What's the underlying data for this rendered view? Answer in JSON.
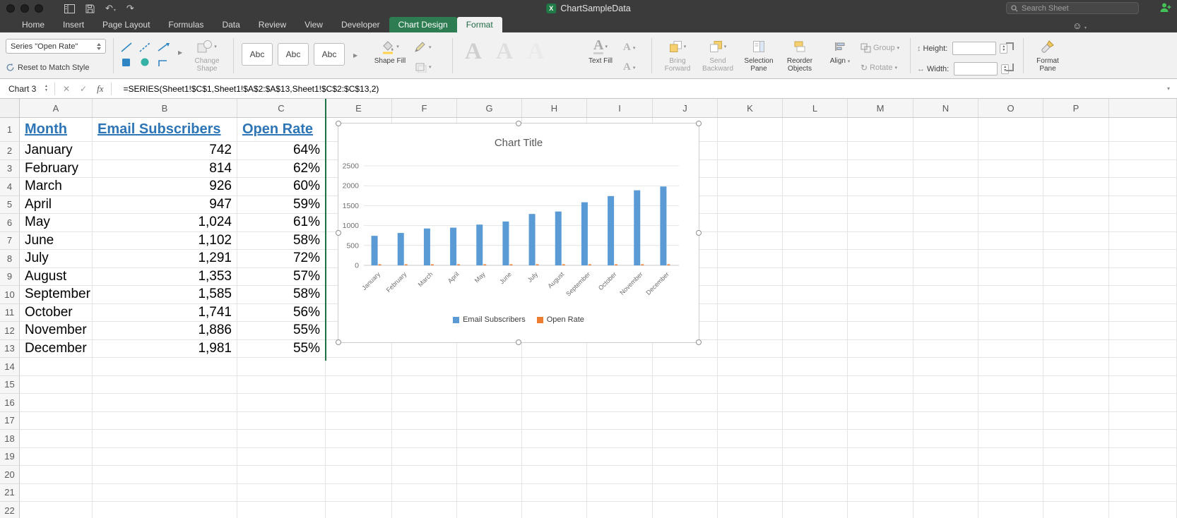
{
  "colors": {
    "accent_green": "#217346",
    "bar_blue": "#5b9bd5",
    "bar_orange": "#ed7d31",
    "link_blue": "#2e75b6"
  },
  "titlebar": {
    "title": "ChartSampleData",
    "search_placeholder": "Search Sheet"
  },
  "tabs": [
    {
      "label": "Home",
      "state": "normal"
    },
    {
      "label": "Insert",
      "state": "normal"
    },
    {
      "label": "Page Layout",
      "state": "normal"
    },
    {
      "label": "Formulas",
      "state": "normal"
    },
    {
      "label": "Data",
      "state": "normal"
    },
    {
      "label": "Review",
      "state": "normal"
    },
    {
      "label": "View",
      "state": "normal"
    },
    {
      "label": "Developer",
      "state": "normal"
    },
    {
      "label": "Chart Design",
      "state": "contextual"
    },
    {
      "label": "Format",
      "state": "active"
    }
  ],
  "ribbon": {
    "series_selector": "Series \"Open Rate\"",
    "reset_button": "Reset to Match Style",
    "change_shape": "Change Shape",
    "style_presets": [
      "Abc",
      "Abc",
      "Abc"
    ],
    "wordart_presets": [
      "A",
      "A",
      "A"
    ],
    "shape_fill": "Shape Fill",
    "text_fill": "Text Fill",
    "bring_forward": "Bring Forward",
    "send_backward": "Send Backward",
    "selection_pane": "Selection Pane",
    "reorder_objects": "Reorder Objects",
    "align": "Align",
    "group": "Group",
    "rotate": "Rotate",
    "height_label": "Height:",
    "width_label": "Width:",
    "height_value": "",
    "width_value": "",
    "format_pane": "Format Pane"
  },
  "formula_bar": {
    "name_box": "Chart 3",
    "fx_label": "fx",
    "formula": "=SERIES(Sheet1!$C$1,Sheet1!$A$2:$A$13,Sheet1!$C$2:$C$13,2)"
  },
  "grid": {
    "columns": [
      "A",
      "B",
      "C",
      "E",
      "F",
      "G",
      "H",
      "I",
      "J",
      "K",
      "L",
      "M",
      "N",
      "O",
      "P",
      ""
    ],
    "row_count": 22,
    "headers": [
      "Month",
      "Email Subscribers",
      "Open Rate"
    ],
    "rows": [
      [
        "January",
        "742",
        "64%"
      ],
      [
        "February",
        "814",
        "62%"
      ],
      [
        "March",
        "926",
        "60%"
      ],
      [
        "April",
        "947",
        "59%"
      ],
      [
        "May",
        "1,024",
        "61%"
      ],
      [
        "June",
        "1,102",
        "58%"
      ],
      [
        "July",
        "1,291",
        "72%"
      ],
      [
        "August",
        "1,353",
        "57%"
      ],
      [
        "September",
        "1,585",
        "58%"
      ],
      [
        "October",
        "1,741",
        "56%"
      ],
      [
        "November",
        "1,886",
        "55%"
      ],
      [
        "December",
        "1,981",
        "55%"
      ]
    ]
  },
  "chart_data": {
    "type": "bar",
    "title": "Chart Title",
    "categories": [
      "January",
      "February",
      "March",
      "April",
      "May",
      "June",
      "July",
      "August",
      "September",
      "October",
      "November",
      "December"
    ],
    "series": [
      {
        "name": "Email Subscribers",
        "color": "#5b9bd5",
        "values": [
          742,
          814,
          926,
          947,
          1024,
          1102,
          1291,
          1353,
          1585,
          1741,
          1886,
          1981
        ]
      },
      {
        "name": "Open Rate",
        "color": "#ed7d31",
        "values": [
          0.64,
          0.62,
          0.6,
          0.59,
          0.61,
          0.58,
          0.72,
          0.57,
          0.58,
          0.56,
          0.55,
          0.55
        ]
      }
    ],
    "y_ticks": [
      0,
      500,
      1000,
      1500,
      2000,
      2500
    ],
    "ylim": [
      0,
      2500
    ],
    "grid": true,
    "legend_position": "bottom"
  }
}
